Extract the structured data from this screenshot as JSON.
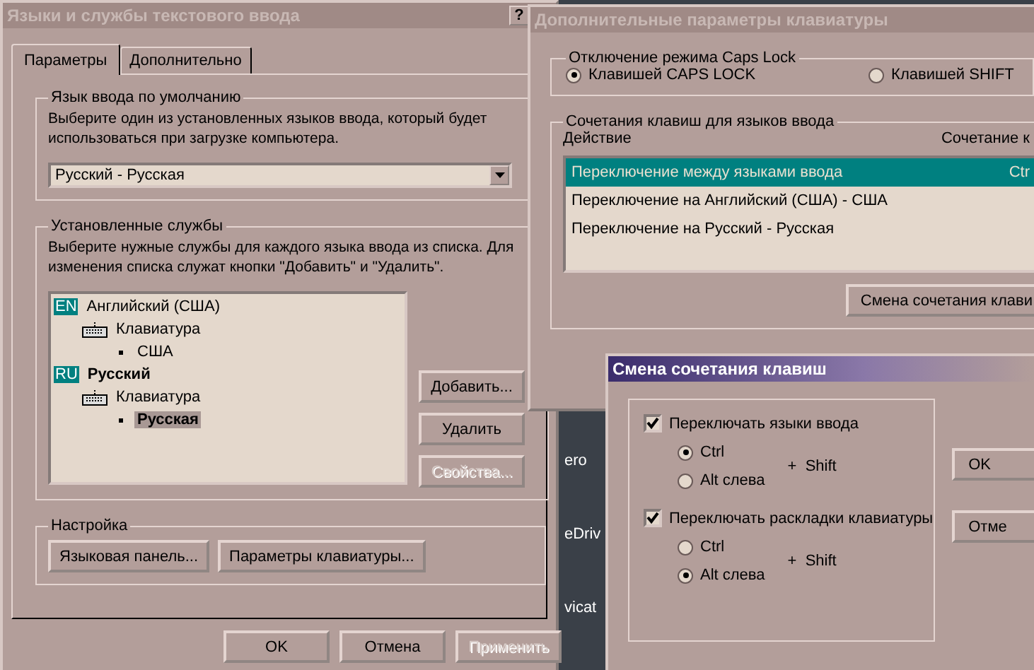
{
  "desktop": {
    "icon_labels": [
      "ero",
      "eDriv",
      "vicat"
    ]
  },
  "main_window": {
    "title": "Языки и службы текстового ввода",
    "help_button": "?",
    "tabs": [
      {
        "label": "Параметры",
        "selected": true
      },
      {
        "label": "Дополнительно",
        "selected": false
      }
    ],
    "default_language": {
      "title": "Язык ввода по умолчанию",
      "description": "Выберите один из установленных языков ввода, который будет использоваться при загрузке компьютера.",
      "value": "Русский - Русская"
    },
    "installed_services": {
      "title": "Установленные службы",
      "description": "Выберите нужные службы для каждого языка ввода из списка. Для изменения списка служат кнопки \"Добавить\" и \"Удалить\".",
      "tree": [
        {
          "badge": "EN",
          "label": "Английский (США)",
          "bold": false,
          "children": [
            {
              "label": "Клавиатура",
              "children": [
                {
                  "label": "США",
                  "bold": false,
                  "selected": false
                }
              ]
            }
          ]
        },
        {
          "badge": "RU",
          "label": "Русский",
          "bold": true,
          "children": [
            {
              "label": "Клавиатура",
              "children": [
                {
                  "label": "Русская",
                  "bold": true,
                  "selected": true
                }
              ]
            }
          ]
        }
      ],
      "buttons": [
        {
          "label": "Добавить...",
          "disabled": false
        },
        {
          "label": "Удалить",
          "disabled": false
        },
        {
          "label": "Свойства...",
          "disabled": true
        }
      ]
    },
    "settings": {
      "title": "Настройка",
      "buttons": [
        "Языковая панель...",
        "Параметры клавиатуры..."
      ]
    },
    "buttons": [
      {
        "label": "OK",
        "disabled": false
      },
      {
        "label": "Отмена",
        "disabled": false
      },
      {
        "label": "Применить",
        "disabled": true
      }
    ]
  },
  "keyboard_window": {
    "title": "Дополнительные параметры клавиатуры",
    "caps_lock": {
      "title": "Отключение режима Caps Lock",
      "options": [
        {
          "label": "Клавишей CAPS LOCK",
          "selected": true
        },
        {
          "label": "Клавишей SHIFT",
          "selected": false
        }
      ]
    },
    "hotkeys": {
      "title": "Сочетания клавиш для языков ввода",
      "columns": [
        "Действие",
        "Сочетание к"
      ],
      "rows": [
        {
          "action": "Переключение между языками ввода",
          "keys": "Ctr",
          "selected": true
        },
        {
          "action": "Переключение на Английский (США) - США",
          "selected": false
        },
        {
          "action": "Переключение на Русский - Русская",
          "selected": false
        }
      ],
      "button": "Смена сочетания клави"
    }
  },
  "hotkey_window": {
    "title": "Смена сочетания клавиш",
    "switches": [
      {
        "label": "Переключать языки ввода",
        "checked": true,
        "options": [
          {
            "label": "Ctrl",
            "selected": true
          },
          {
            "label": "Alt слева",
            "selected": false
          }
        ],
        "modifier": "+  Shift"
      },
      {
        "label": "Переключать раскладки клавиатуры",
        "checked": true,
        "options": [
          {
            "label": "Ctrl",
            "selected": false
          },
          {
            "label": "Alt слева",
            "selected": true
          }
        ],
        "modifier": "+  Shift"
      }
    ],
    "buttons": [
      "OK",
      "Отме"
    ]
  }
}
